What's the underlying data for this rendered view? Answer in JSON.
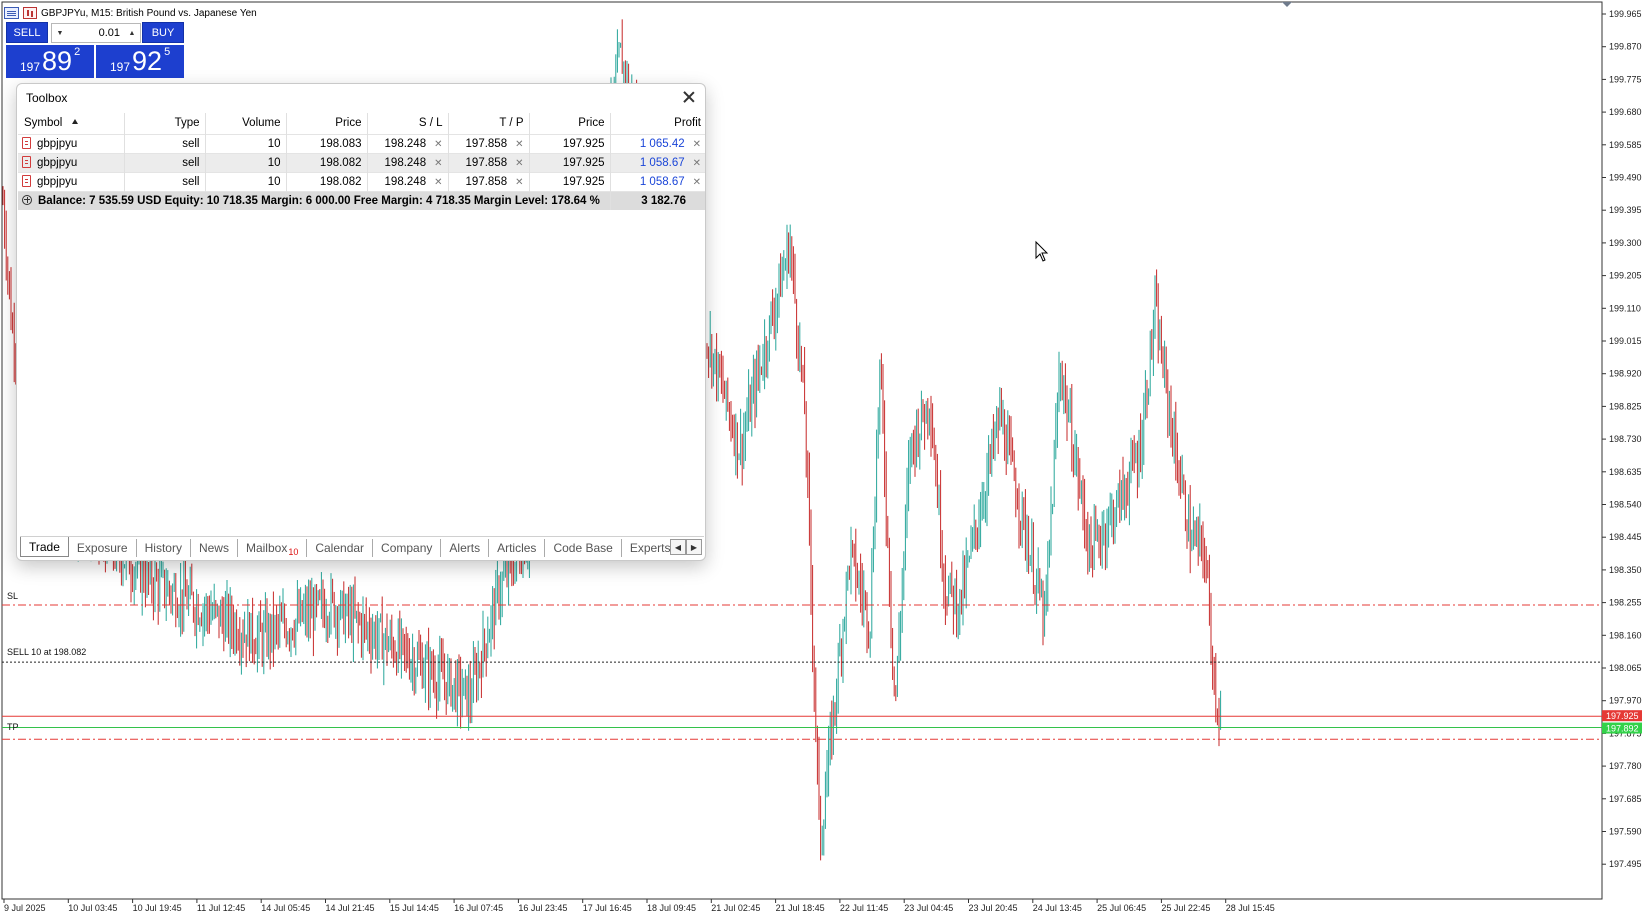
{
  "chart": {
    "title": "GBPJPYu, M15:  British Pound vs. Japanese Yen",
    "price_axis": [
      "199.965",
      "199.870",
      "199.775",
      "199.680",
      "199.585",
      "199.490",
      "199.395",
      "199.300",
      "199.205",
      "199.110",
      "199.015",
      "198.920",
      "198.825",
      "198.730",
      "198.635",
      "198.540",
      "198.445",
      "198.350",
      "198.255",
      "198.160",
      "198.065",
      "197.970",
      "197.875",
      "197.780",
      "197.685",
      "197.590",
      "197.495"
    ],
    "time_axis": [
      "9 Jul 2025",
      "10 Jul 03:45",
      "10 Jul 19:45",
      "11 Jul 12:45",
      "14 Jul 05:45",
      "14 Jul 21:45",
      "15 Jul 14:45",
      "16 Jul 07:45",
      "16 Jul 23:45",
      "17 Jul 16:45",
      "18 Jul 09:45",
      "21 Jul 02:45",
      "21 Jul 18:45",
      "22 Jul 11:45",
      "23 Jul 04:45",
      "23 Jul 20:45",
      "24 Jul 13:45",
      "25 Jul 06:45",
      "25 Jul 22:45",
      "28 Jul 15:45"
    ],
    "bid_price_tag": "197.925",
    "tp_price_tag": "197.892",
    "sl_label": "SL",
    "sell_label": "SELL 10 at 198.082",
    "tp_label": "TP",
    "up_color": "#26a69a",
    "down_color": "#c62828"
  },
  "trade_panel": {
    "sell": "SELL",
    "buy": "BUY",
    "lot": "0.01",
    "bid_small": "197",
    "bid_big": "89",
    "bid_sup": "2",
    "ask_small": "197",
    "ask_big": "92",
    "ask_sup": "5"
  },
  "toolbox": {
    "title": "Toolbox",
    "columns": [
      "Symbol",
      "Type",
      "Volume",
      "Price",
      "S / L",
      "T / P",
      "Price",
      "Profit"
    ],
    "rows": [
      {
        "symbol": "gbpjpyu",
        "type": "sell",
        "volume": "10",
        "price": "198.083",
        "sl": "198.248",
        "tp": "197.858",
        "current": "197.925",
        "profit": "1 065.42"
      },
      {
        "symbol": "gbpjpyu",
        "type": "sell",
        "volume": "10",
        "price": "198.082",
        "sl": "198.248",
        "tp": "197.858",
        "current": "197.925",
        "profit": "1 058.67"
      },
      {
        "symbol": "gbpjpyu",
        "type": "sell",
        "volume": "10",
        "price": "198.082",
        "sl": "198.248",
        "tp": "197.858",
        "current": "197.925",
        "profit": "1 058.67"
      }
    ],
    "summary": "Balance: 7 535.59 USD  Equity: 10 718.35  Margin: 6 000.00  Free Margin: 4 718.35  Margin Level: 178.64 %",
    "summary_total": "3 182.76",
    "tabs": [
      "Trade",
      "Exposure",
      "History",
      "News",
      "Mailbox",
      "Calendar",
      "Company",
      "Alerts",
      "Articles",
      "Code Base",
      "Experts"
    ],
    "mailbox_badge": "10"
  }
}
